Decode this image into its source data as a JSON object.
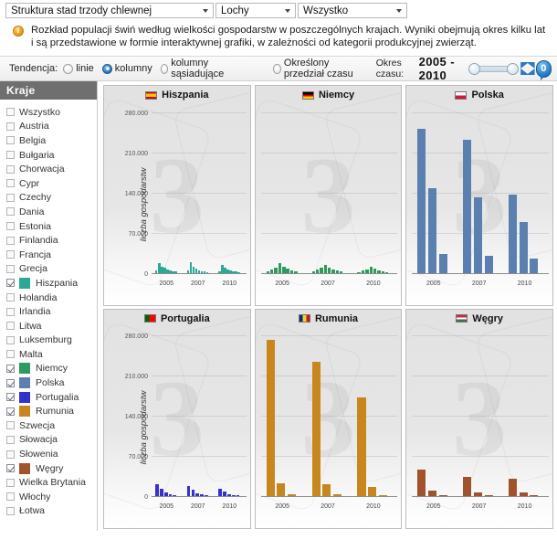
{
  "selectors": [
    {
      "name": "structure",
      "value": "Struktura stad trzody chlewnej"
    },
    {
      "name": "category",
      "value": "Lochy"
    },
    {
      "name": "scope",
      "value": "Wszystko"
    }
  ],
  "info": {
    "icon": "info-icon",
    "text": "Rozkład populacji świń według wielkości gospodarstw w poszczególnych krajach. Wyniki obejmują okres kilku lat i są przedstawione w formie interaktywnej grafiki, w zależności od kategorii produkcyjnej zwierząt."
  },
  "toolbar": {
    "tendency_label": "Tendencja:",
    "options": [
      {
        "label": "linie",
        "selected": false
      },
      {
        "label": "kolumny",
        "selected": true
      },
      {
        "label": "kolumny sąsiadujące",
        "selected": false
      }
    ],
    "time_range_option": {
      "label": "Określony przedział czasu",
      "selected": false
    },
    "period_label": "Okres czasu:",
    "period_value": "2005 - 2010",
    "expand_icon": "expand-arrows-icon",
    "badge_value": "0"
  },
  "sidebar": {
    "header": "Kraje",
    "items": [
      {
        "label": "Wszystko",
        "checked": false,
        "color": null
      },
      {
        "label": "Austria",
        "checked": false,
        "color": null
      },
      {
        "label": "Belgia",
        "checked": false,
        "color": null
      },
      {
        "label": "Bułgaria",
        "checked": false,
        "color": null
      },
      {
        "label": "Chorwacja",
        "checked": false,
        "color": null
      },
      {
        "label": "Cypr",
        "checked": false,
        "color": null
      },
      {
        "label": "Czechy",
        "checked": false,
        "color": null
      },
      {
        "label": "Dania",
        "checked": false,
        "color": null
      },
      {
        "label": "Estonia",
        "checked": false,
        "color": null
      },
      {
        "label": "Finlandia",
        "checked": false,
        "color": null
      },
      {
        "label": "Francja",
        "checked": false,
        "color": null
      },
      {
        "label": "Grecja",
        "checked": false,
        "color": null
      },
      {
        "label": "Hiszpania",
        "checked": true,
        "color": "#2BA896"
      },
      {
        "label": "Holandia",
        "checked": false,
        "color": null
      },
      {
        "label": "Irlandia",
        "checked": false,
        "color": null
      },
      {
        "label": "Litwa",
        "checked": false,
        "color": null
      },
      {
        "label": "Luksemburg",
        "checked": false,
        "color": null
      },
      {
        "label": "Malta",
        "checked": false,
        "color": null
      },
      {
        "label": "Niemcy",
        "checked": true,
        "color": "#2E9B5E"
      },
      {
        "label": "Polska",
        "checked": true,
        "color": "#5B7FAF"
      },
      {
        "label": "Portugalia",
        "checked": true,
        "color": "#3333CC"
      },
      {
        "label": "Rumunia",
        "checked": true,
        "color": "#C8861E"
      },
      {
        "label": "Szwecja",
        "checked": false,
        "color": null
      },
      {
        "label": "Słowacja",
        "checked": false,
        "color": null
      },
      {
        "label": "Słowenia",
        "checked": false,
        "color": null
      },
      {
        "label": "Węgry",
        "checked": true,
        "color": "#A0522D"
      },
      {
        "label": "Wielka Brytania",
        "checked": false,
        "color": null
      },
      {
        "label": "Włochy",
        "checked": false,
        "color": null
      },
      {
        "label": "Łotwa",
        "checked": false,
        "color": null
      }
    ]
  },
  "chart_data": [
    {
      "type": "bar",
      "title": "Hiszpania",
      "flag": "flag-es",
      "color": "#2BA896",
      "ylabel": "liczba gospodarstw",
      "xlabel": "",
      "ylim": [
        0,
        280000
      ],
      "yticks": [
        0,
        70000,
        140000,
        210000,
        280000
      ],
      "ytick_labels": [
        "0",
        "70.000",
        "140.000",
        "210.000",
        "280.000"
      ],
      "xticks": [
        "2005",
        "2007",
        "2010"
      ],
      "grid": true,
      "groups": [
        {
          "x": "2005",
          "values": [
            4000,
            17000,
            11000,
            8000,
            5000,
            3500,
            2500,
            1800
          ]
        },
        {
          "x": "2007",
          "values": [
            3500,
            19000,
            10000,
            7000,
            4500,
            3000,
            2200,
            1500
          ]
        },
        {
          "x": "2010",
          "values": [
            3000,
            14000,
            9000,
            6000,
            4000,
            2500,
            1800,
            1200
          ]
        }
      ]
    },
    {
      "type": "bar",
      "title": "Niemcy",
      "flag": "flag-de",
      "color": "#2E9B5E",
      "ylabel": "",
      "xlabel": "",
      "ylim": [
        0,
        280000
      ],
      "yticks": [
        0,
        70000,
        140000,
        210000,
        280000
      ],
      "ytick_labels": [
        "0",
        "70.000",
        "140.000",
        "210.000",
        "280.000"
      ],
      "xticks": [
        "2005",
        "2007",
        "2010"
      ],
      "grid": true,
      "groups": [
        {
          "x": "2005",
          "values": [
            2500,
            6000,
            9000,
            16000,
            11000,
            7000,
            4000,
            2000
          ]
        },
        {
          "x": "2007",
          "values": [
            2000,
            5000,
            8000,
            13000,
            9000,
            6000,
            3500,
            1800
          ]
        },
        {
          "x": "2010",
          "values": [
            1500,
            3500,
            6000,
            10000,
            7000,
            4500,
            2500,
            1200
          ]
        }
      ]
    },
    {
      "type": "bar",
      "title": "Polska",
      "flag": "flag-pl",
      "color": "#5B7FAF",
      "ylabel": "",
      "xlabel": "",
      "ylim": [
        0,
        280000
      ],
      "yticks": [
        0,
        70000,
        140000,
        210000,
        280000
      ],
      "ytick_labels": [
        "0",
        "70.000",
        "140.000",
        "210.000",
        "280.000"
      ],
      "xticks": [
        "2005",
        "2007",
        "2010"
      ],
      "grid": true,
      "groups": [
        {
          "x": "2005",
          "values": [
            250000,
            147000,
            32000
          ]
        },
        {
          "x": "2007",
          "values": [
            232000,
            131000,
            30000
          ]
        },
        {
          "x": "2010",
          "values": [
            136000,
            88000,
            25000
          ]
        }
      ]
    },
    {
      "type": "bar",
      "title": "Portugalia",
      "flag": "flag-pt",
      "color": "#3333CC",
      "ylabel": "liczba gospodarstw",
      "xlabel": "",
      "ylim": [
        0,
        280000
      ],
      "yticks": [
        0,
        70000,
        140000,
        210000,
        280000
      ],
      "ytick_labels": [
        "0",
        "70.000",
        "140.000",
        "210.000",
        "280.000"
      ],
      "xticks": [
        "2005",
        "2007",
        "2010"
      ],
      "grid": true,
      "groups": [
        {
          "x": "2005",
          "values": [
            20000,
            13000,
            6000,
            3000,
            1500
          ]
        },
        {
          "x": "2007",
          "values": [
            18000,
            11000,
            5000,
            2500,
            1200
          ]
        },
        {
          "x": "2010",
          "values": [
            12000,
            8000,
            4000,
            2000,
            1000
          ]
        }
      ]
    },
    {
      "type": "bar",
      "title": "Rumunia",
      "flag": "flag-ro",
      "color": "#C8861E",
      "ylabel": "",
      "xlabel": "",
      "ylim": [
        0,
        280000
      ],
      "yticks": [
        0,
        70000,
        140000,
        210000,
        280000
      ],
      "ytick_labels": [
        "0",
        "70.000",
        "140.000",
        "210.000",
        "280.000"
      ],
      "xticks": [
        "2005",
        "2007",
        "2010"
      ],
      "grid": true,
      "groups": [
        {
          "x": "2005",
          "values": [
            272000,
            22000,
            3000
          ]
        },
        {
          "x": "2007",
          "values": [
            234000,
            20000,
            2500
          ]
        },
        {
          "x": "2010",
          "values": [
            172000,
            16000,
            2000
          ]
        }
      ]
    },
    {
      "type": "bar",
      "title": "Węgry",
      "flag": "flag-hu",
      "color": "#A0522D",
      "ylabel": "",
      "xlabel": "",
      "ylim": [
        0,
        280000
      ],
      "yticks": [
        0,
        70000,
        140000,
        210000,
        280000
      ],
      "ytick_labels": [
        "0",
        "70.000",
        "140.000",
        "210.000",
        "280.000"
      ],
      "xticks": [
        "2005",
        "2007",
        "2010"
      ],
      "grid": true,
      "groups": [
        {
          "x": "2005",
          "values": [
            46000,
            9000,
            2000
          ]
        },
        {
          "x": "2007",
          "values": [
            34000,
            6000,
            1500
          ]
        },
        {
          "x": "2010",
          "values": [
            30000,
            7000,
            1500
          ]
        }
      ]
    }
  ]
}
